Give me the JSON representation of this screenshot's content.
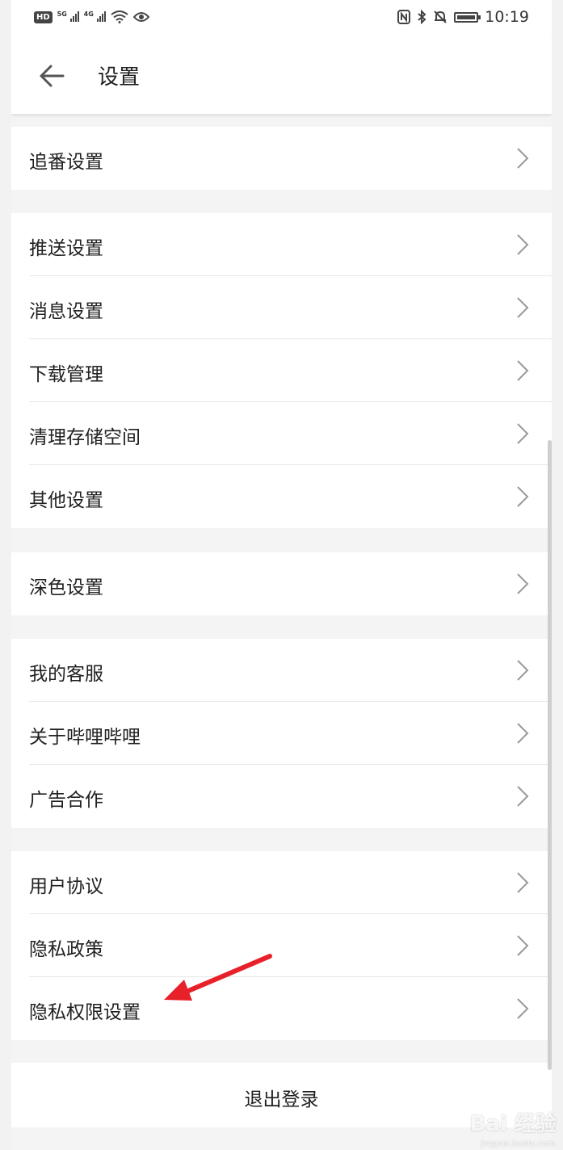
{
  "status_bar": {
    "hd_label": "HD",
    "network_1": "5G",
    "network_2": "4G",
    "time": "10:19"
  },
  "app_bar": {
    "title": "设置"
  },
  "groups": [
    {
      "items": [
        "追番设置"
      ]
    },
    {
      "items": [
        "推送设置",
        "消息设置",
        "下载管理",
        "清理存储空间",
        "其他设置"
      ]
    },
    {
      "items": [
        "深色设置"
      ]
    },
    {
      "items": [
        "我的客服",
        "关于哔哩哔哩",
        "广告合作"
      ]
    },
    {
      "items": [
        "用户协议",
        "隐私政策",
        "隐私权限设置"
      ]
    }
  ],
  "logout_label": "退出登录",
  "watermark": {
    "brand": "Bai 经验",
    "url": "jingyan.baidu.com"
  },
  "colors": {
    "annotation_arrow": "#e8202a",
    "background": "#f4f4f4"
  }
}
